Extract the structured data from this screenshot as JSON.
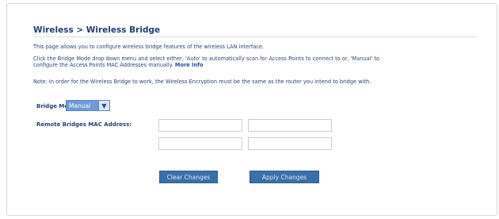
{
  "page": {
    "title": "Wireless > Wireless Bridge",
    "intro": "This page allows you to configure wireless bridge features of the wireless LAN interface.",
    "instructions_line1": "Click the Bridge Mode drop down menu and select either, 'Auto' to automatically scan for Access Points to connect to or, 'Manual' to",
    "instructions_line2": "configure the Access Points MAC Addresses manually.",
    "more_info": "More Info",
    "note": "Note: In order for the Wireless Bridge to work, the Wireless Encryption must be the same as the router you intend to bridge with."
  },
  "form": {
    "bridge_mode_label": "Bridge Mode:",
    "bridge_mode_value": "Manual",
    "mac_label": "Remote Bridges MAC Address:",
    "mac_values": [
      "",
      "",
      "",
      ""
    ]
  },
  "buttons": {
    "clear": "Clear Changes",
    "apply": "Apply Changes"
  },
  "colors": {
    "title": "#233b73",
    "button": "#3a6fa8",
    "select": "#6f9ad6"
  }
}
